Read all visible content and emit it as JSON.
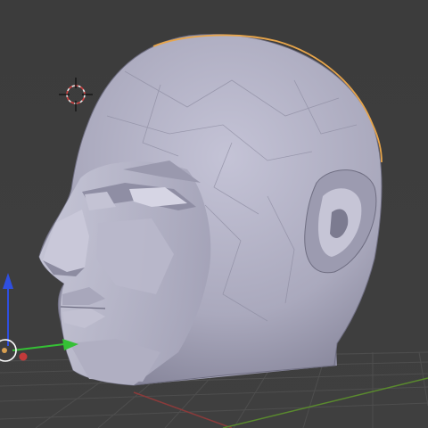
{
  "viewport": {
    "background": "#3d3d3d",
    "grid_color": "#4e4e4e",
    "x_axis_color": "#8a3b3b",
    "y_axis_color": "#5a8a2e"
  },
  "object": {
    "icon": "low-poly-head-mesh",
    "base_color": "#b6b5c8",
    "selection_outline_color": "#e7a54b"
  },
  "gizmos": {
    "cursor_icon": "3d-cursor-icon",
    "transform_icon": "translate-gizmo-icon",
    "axis_colors": {
      "x": "#c33a3a",
      "y": "#35c035",
      "z": "#2f4fe0"
    }
  }
}
